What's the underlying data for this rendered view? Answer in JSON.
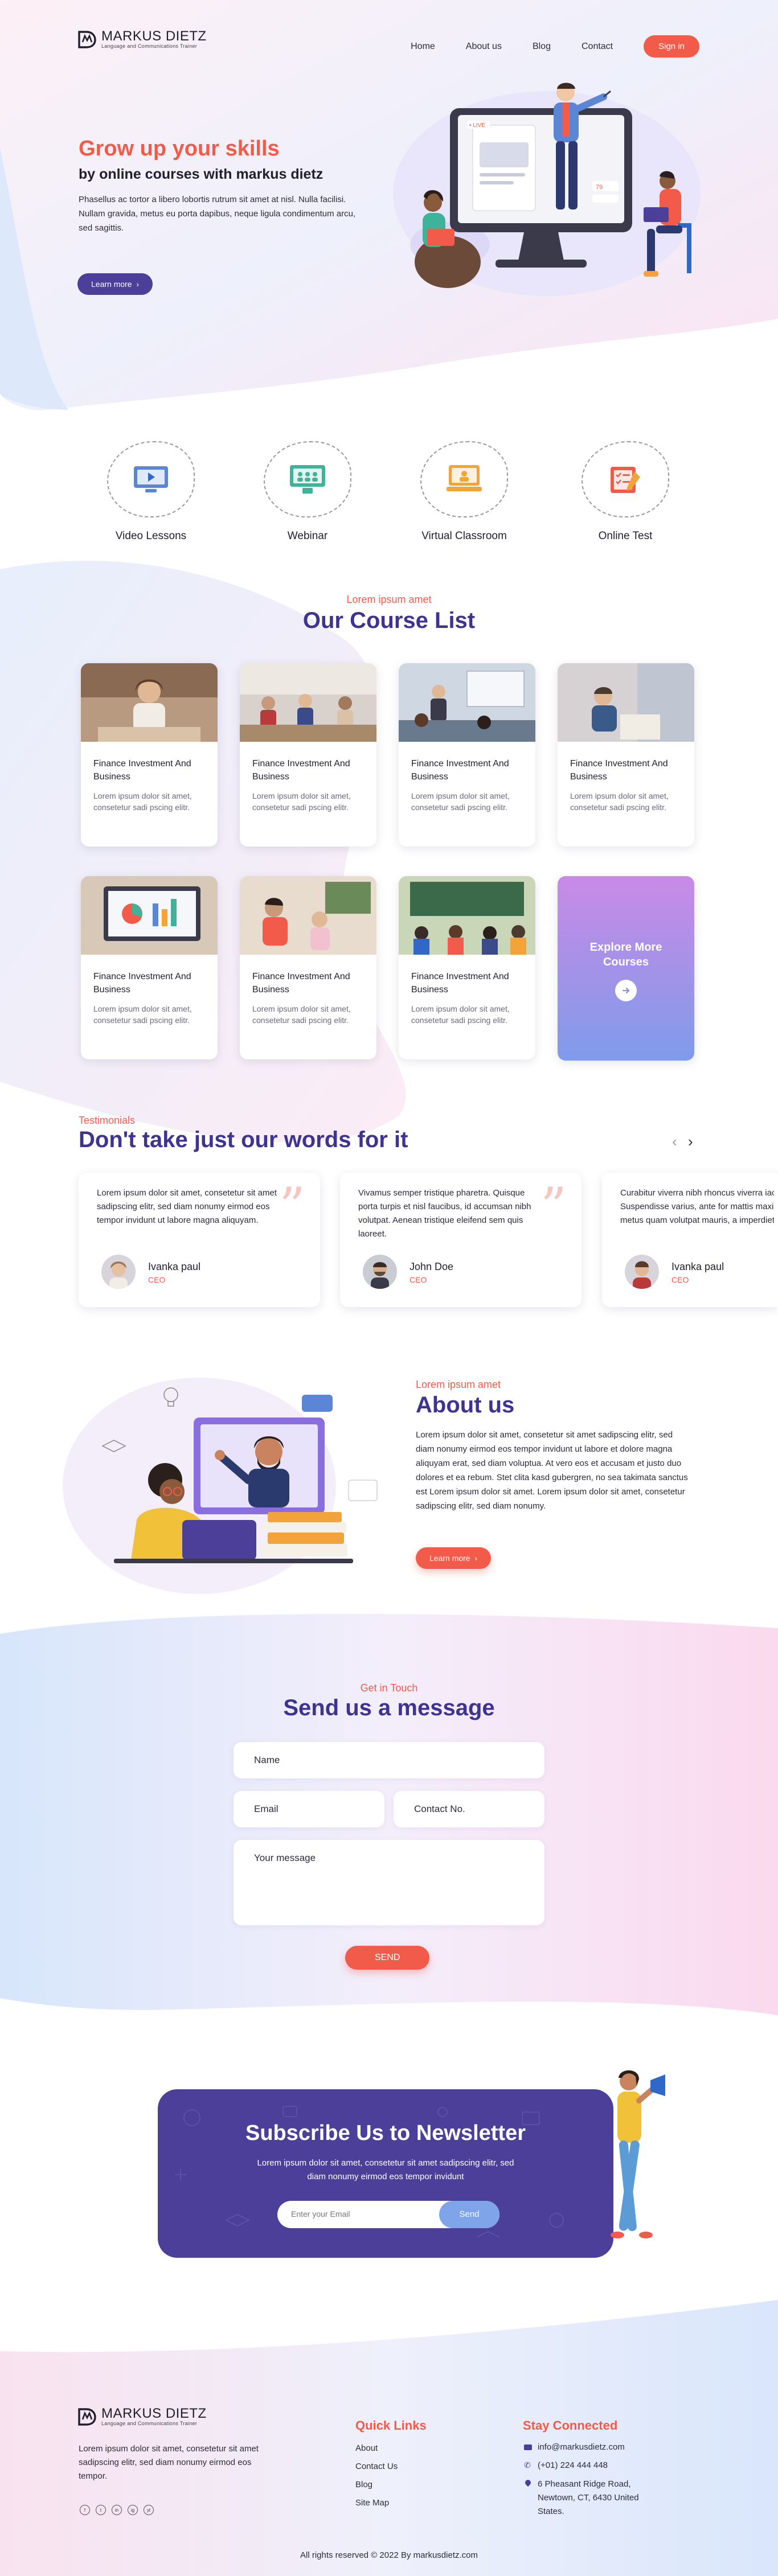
{
  "brand": {
    "name": "MARKUS DIETZ",
    "tagline": "Language and Communications Trainer"
  },
  "nav": {
    "items": [
      "Home",
      "About us",
      "Blog",
      "Contact"
    ],
    "signin": "Sign in"
  },
  "hero": {
    "title": "Grow up your skills",
    "subtitle": "by online courses with markus dietz",
    "text": "Phasellus ac tortor a libero lobortis rutrum sit amet at nisl. Nulla facilisi. Nullam gravida, metus eu porta dapibus, neque ligula condimentum arcu, sed sagittis.",
    "cta": "Learn more",
    "live_badge": "• LIVE",
    "viewer_count": "79"
  },
  "features": [
    {
      "label": "Video Lessons",
      "icon": "video-lesson-icon"
    },
    {
      "label": "Webinar",
      "icon": "webinar-icon"
    },
    {
      "label": "Virtual Classroom",
      "icon": "virtual-classroom-icon"
    },
    {
      "label": "Online Test",
      "icon": "online-test-icon"
    }
  ],
  "courses": {
    "kicker": "Lorem ipsum amet",
    "title": "Our Course List",
    "items": [
      {
        "title": "Finance Investment And Business",
        "desc": "Lorem ipsum dolor sit amet, consetetur sadi pscing elitr."
      },
      {
        "title": "Finance Investment And Business",
        "desc": "Lorem ipsum dolor sit amet, consetetur sadi pscing elitr."
      },
      {
        "title": "Finance Investment And Business",
        "desc": "Lorem ipsum dolor sit amet, consetetur sadi pscing elitr."
      },
      {
        "title": "Finance Investment And Business",
        "desc": "Lorem ipsum dolor sit amet, consetetur sadi pscing elitr."
      },
      {
        "title": "Finance Investment And Business",
        "desc": "Lorem ipsum dolor sit amet, consetetur sadi pscing elitr."
      },
      {
        "title": "Finance Investment And Business",
        "desc": "Lorem ipsum dolor sit amet, consetetur sadi pscing elitr."
      },
      {
        "title": "Finance Investment And Business",
        "desc": "Lorem ipsum dolor sit amet, consetetur sadi pscing elitr."
      }
    ],
    "explore": "Explore More Courses"
  },
  "testimonials": {
    "kicker": "Testimonials",
    "title": "Don't take just our words for it",
    "items": [
      {
        "text": "Lorem ipsum dolor sit amet, consetetur sit amet sadipscing elitr, sed diam nonumy eirmod eos tempor invidunt ut labore magna aliquyam.",
        "name": "Ivanka paul",
        "role": "CEO"
      },
      {
        "text": "Vivamus semper tristique pharetra. Quisque porta turpis et nisl faucibus, id accumsan nibh volutpat. Aenean tristique eleifend sem quis laoreet.",
        "name": "John Doe",
        "role": "CEO"
      },
      {
        "text": "Curabitur viverra nibh rhoncus viverra iaculis. Suspendisse varius, ante for mattis maximus, metus quam volutpat mauris, a imperdiet.",
        "name": "Ivanka paul",
        "role": "CEO"
      }
    ]
  },
  "about": {
    "kicker": "Lorem ipsum amet",
    "title": "About us",
    "text": "Lorem ipsum dolor sit amet, consetetur sit amet sadipscing elitr, sed diam nonumy eirmod eos tempor invidunt ut labore et dolore magna aliquyam erat, sed diam voluptua. At vero eos et accusam et justo duo dolores et ea rebum. Stet clita kasd gubergren, no sea takimata sanctus est Lorem ipsum dolor sit amet. Lorem ipsum dolor sit amet, consetetur sadipscing elitr, sed diam nonumy.",
    "cta": "Learn more"
  },
  "contact": {
    "kicker": "Get in Touch",
    "title": "Send us a message",
    "name_placeholder": "Name",
    "email_placeholder": "Email",
    "phone_placeholder": "Contact No.",
    "message_placeholder": "Your message",
    "submit": "SEND"
  },
  "newsletter": {
    "title": "Subscribe Us to Newsletter",
    "text": "Lorem ipsum dolor sit amet, consetetur sit amet sadipscing elitr, sed diam nonumy eirmod eos tempor invidunt",
    "placeholder": "Enter your Email",
    "button": "Send"
  },
  "footer": {
    "about": "Lorem ipsum dolor sit amet, consetetur sit amet sadipscing elitr, sed diam nonumy eirmod eos tempor.",
    "social": [
      "f",
      "t",
      "in",
      "ig",
      "yt"
    ],
    "links_title": "Quick Links",
    "links": [
      "About",
      "Contact Us",
      "Blog",
      "Site Map"
    ],
    "connect_title": "Stay Connected",
    "email": "info@markusdietz.com",
    "phone": "(+01) 224 444 448",
    "address": "6 Pheasant Ridge Road, Newtown, CT, 6430 United States.",
    "copyright": "All rights reserved © 2022 By markusdietz.com"
  },
  "colors": {
    "accent": "#f25a4a",
    "brand_purple": "#4b3f9a",
    "heading_purple": "#3e338f"
  }
}
